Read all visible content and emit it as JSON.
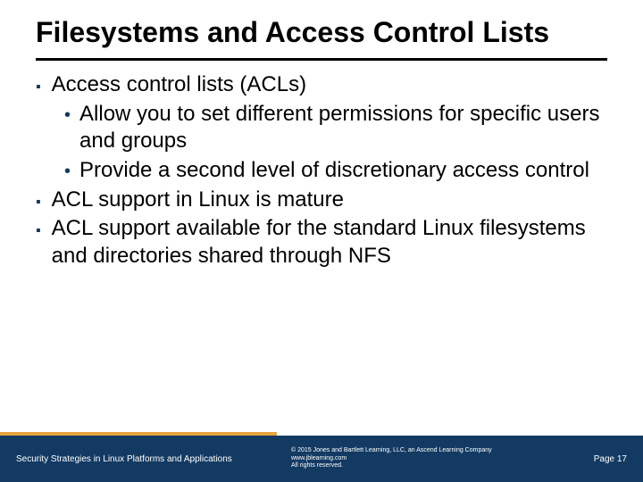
{
  "title": "Filesystems and Access Control Lists",
  "bullets": {
    "b1": "Access control lists (ACLs)",
    "b1a": "Allow you to set different permissions for specific users and groups",
    "b1b": "Provide a second level of discretionary access control",
    "b2": "ACL support in Linux is mature",
    "b3": "ACL support available for the standard Linux filesystems and directories shared through NFS"
  },
  "footer": {
    "left": "Security Strategies in Linux Platforms and Applications",
    "copyright": "© 2015 Jones and Bartlett Learning, LLC, an Ascend Learning Company",
    "site": "www.jblearning.com",
    "rights": "All rights reserved.",
    "page": "Page 17"
  }
}
